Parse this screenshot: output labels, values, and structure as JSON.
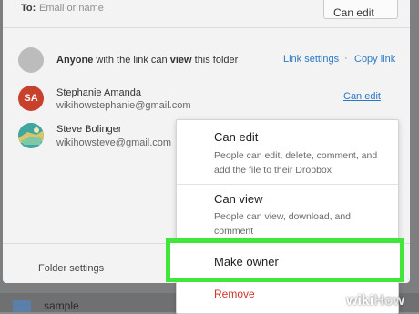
{
  "backdrop": {
    "folder_label": "sample"
  },
  "share": {
    "to_label": "To:",
    "to_placeholder": "Email or name",
    "permission_button": "Can edit"
  },
  "anyone": {
    "prefix": "Anyone",
    "middle": " with the link can ",
    "perm": "view",
    "suffix": " this folder",
    "link_settings": "Link settings",
    "separator": "·",
    "copy_link": "Copy link"
  },
  "members": [
    {
      "initials": "SA",
      "name": "Stephanie Amanda",
      "email": "wikihowstephanie@gmail.com",
      "permission": "Can edit"
    },
    {
      "initials": "",
      "name": "Steve Bolinger",
      "email": "wikihowsteve@gmail.com",
      "permission": ""
    }
  ],
  "footer": {
    "folder_settings": "Folder settings"
  },
  "menu": {
    "can_edit_title": "Can edit",
    "can_edit_desc": "People can edit, delete, comment, and add the file to their Dropbox",
    "can_view_title": "Can view",
    "can_view_desc": "People can view, download, and comment",
    "make_owner": "Make owner",
    "remove": "Remove",
    "highlight_color": "#41e63a"
  },
  "watermark": {
    "wiki": "wiki",
    "how": "How"
  }
}
